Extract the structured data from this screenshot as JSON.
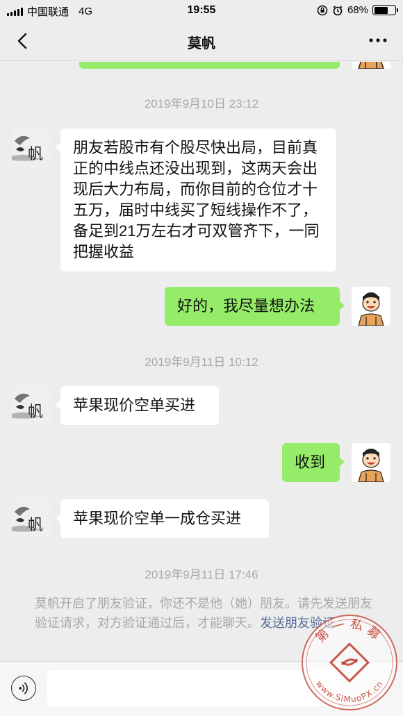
{
  "status_bar": {
    "carrier": "中国联通",
    "network": "4G",
    "time": "19:55",
    "battery": "68%",
    "battery_level": 0.68
  },
  "nav": {
    "title": "莫帆",
    "back_icon": "chevron-left-icon",
    "more_icon": "more-dots-icon"
  },
  "messages": [
    {
      "type": "timestamp",
      "text": "2019年9月10日 23:12"
    },
    {
      "type": "in",
      "text": "朋友若股市有个股尽快出局，目前真正的中线点还没出现到，这两天会出现后大力布局，而你目前的仓位才十五万，届时中线买了短线操作不了，备足到21万左右才可双管齐下，一同把握收益"
    },
    {
      "type": "out",
      "text": "好的，我尽量想办法"
    },
    {
      "type": "timestamp",
      "text": "2019年9月11日 10:12"
    },
    {
      "type": "in",
      "text": "苹果现价空单买进"
    },
    {
      "type": "out",
      "text": "收到"
    },
    {
      "type": "in",
      "text": "苹果现价空单一成仓买进"
    },
    {
      "type": "timestamp",
      "text": "2019年9月11日 17:46"
    }
  ],
  "system_notice": {
    "text": "莫帆开启了朋友验证，你还不是他（她）朋友。请先发送朋友验证请求，对方验证通过后，才能聊天。",
    "link": "发送朋友验证"
  },
  "avatars": {
    "contact_text": "帆"
  },
  "input_bar": {
    "voice_icon": "voice-icon",
    "placeholder": ""
  },
  "watermark": {
    "top_text": "第一私募",
    "bottom_text": "www.SiMuoPX.cn"
  },
  "colors": {
    "background": "#ededed",
    "outgoing_bubble": "#95ec69",
    "incoming_bubble": "#ffffff",
    "timestamp": "#a8a8a8",
    "link": "#576b95",
    "watermark": "#c0392b"
  }
}
